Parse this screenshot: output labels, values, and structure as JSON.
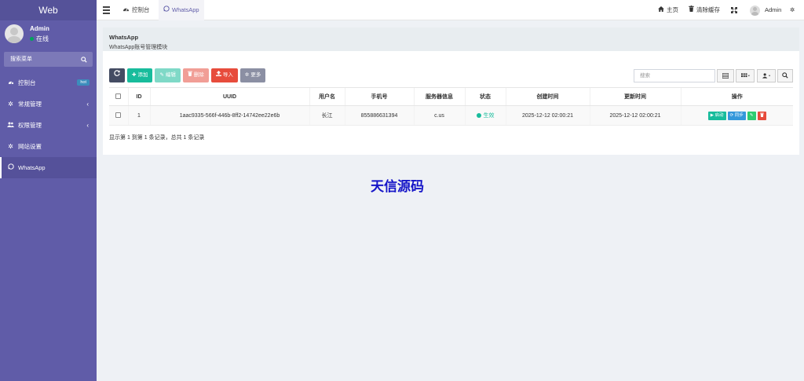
{
  "sidebar": {
    "logo": "Web",
    "user": {
      "name": "Admin",
      "status": "在线"
    },
    "search_placeholder": "搜索菜单",
    "items": [
      {
        "label": "控制台",
        "icon": "dashboard-icon",
        "badge": "hot"
      },
      {
        "label": "常规管理",
        "icon": "cogs-icon"
      },
      {
        "label": "权限管理",
        "icon": "group-icon"
      },
      {
        "label": "网站设置",
        "icon": "cogs-icon"
      },
      {
        "label": "WhatsApp",
        "icon": "whatsapp-icon",
        "active": true
      }
    ]
  },
  "topbar": {
    "tabs": [
      {
        "label": "控制台",
        "icon": "dashboard-icon"
      },
      {
        "label": "WhatsApp",
        "icon": "whatsapp-icon",
        "active": true
      }
    ],
    "home": "主页",
    "clear_cache": "清除缓存",
    "user": "Admin"
  },
  "panel": {
    "title": "WhatsApp",
    "subtitle": "WhatsApp账号管理模块"
  },
  "toolbar": {
    "add": "添加",
    "edit": "编辑",
    "delete": "删除",
    "import": "导入",
    "more": "更多",
    "search_placeholder": "搜索"
  },
  "table": {
    "columns": [
      "ID",
      "UUID",
      "用户名",
      "手机号",
      "服务器信息",
      "状态",
      "创建时间",
      "更新时间",
      "操作"
    ],
    "rows": [
      {
        "id": "1",
        "uuid": "1aac9335-566f-446b-8ff2-14742ee22e6b",
        "username": "长江",
        "phone": "855886631394",
        "server": "c.us",
        "status": "生效",
        "created": "2025-12-12 02:00:21",
        "updated": "2025-12-12 02:00:21",
        "ops": {
          "start": "启动",
          "sync": "同步"
        }
      }
    ]
  },
  "pager": "显示第 1 到第 1 条记录，总共 1 条记录",
  "watermark": "天信源码",
  "colors": {
    "sidebar": "#605ca8",
    "add": "#18bc9c",
    "import": "#e74c3c",
    "sync": "#3498db"
  }
}
